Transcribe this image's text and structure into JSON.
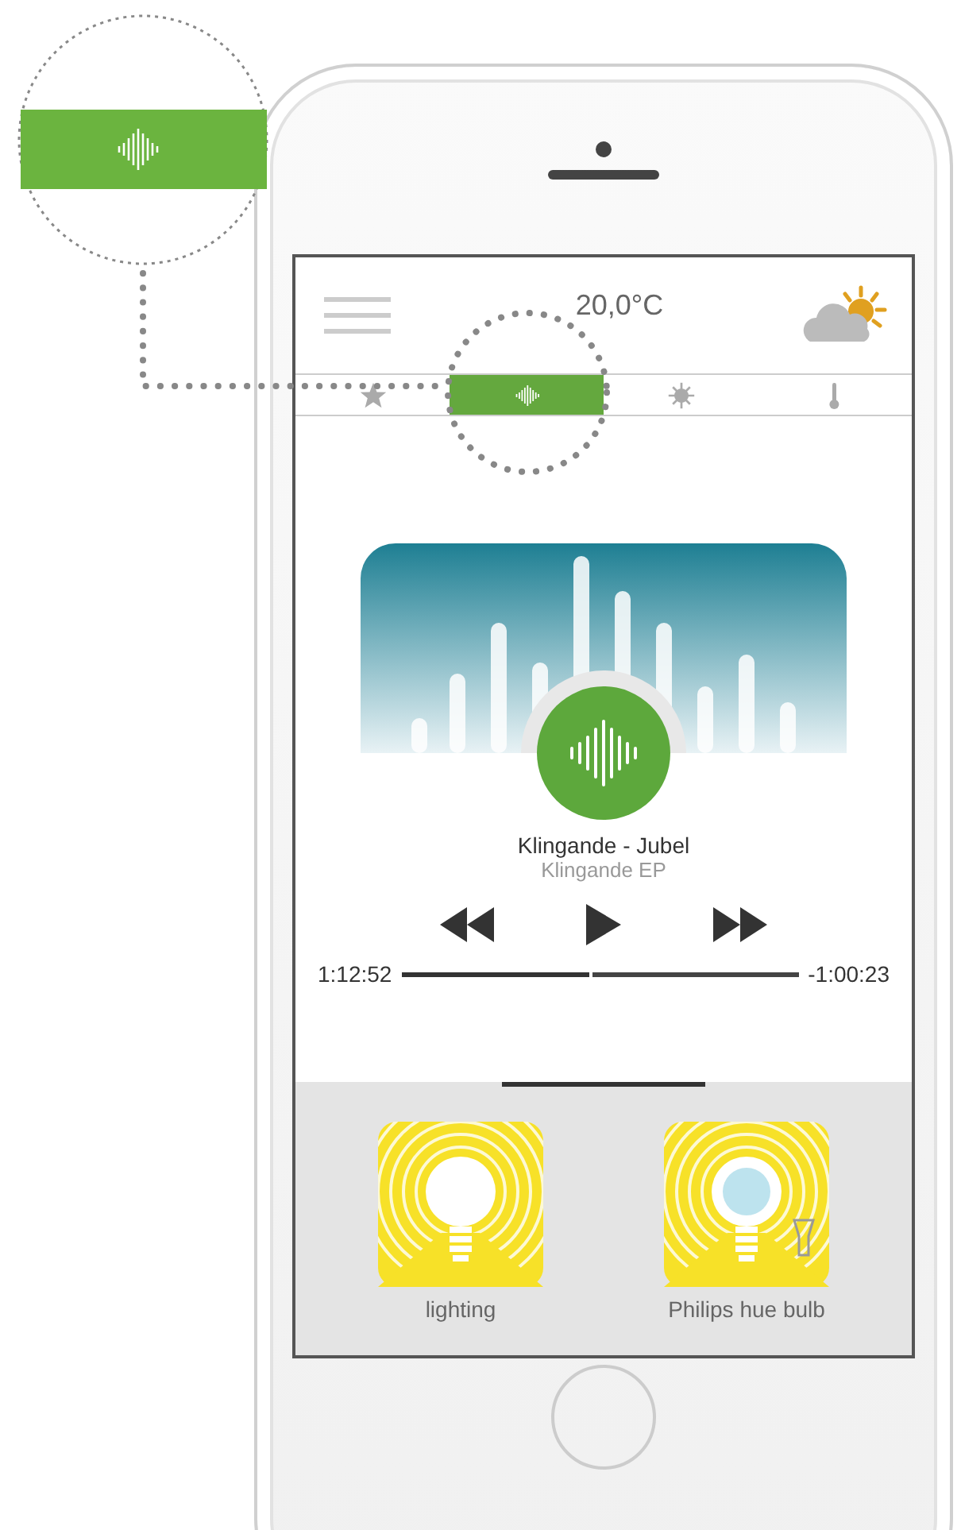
{
  "header": {
    "temperature": "20,0°C"
  },
  "tabs": [
    {
      "kind": "favorites",
      "selected": false
    },
    {
      "kind": "sound",
      "selected": true
    },
    {
      "kind": "light",
      "selected": false
    },
    {
      "kind": "temperature",
      "selected": false
    }
  ],
  "player": {
    "title": "Klingande - Jubel",
    "album": "Klingande EP",
    "elapsed": "1:12:52",
    "remaining": "-1:00:23",
    "level": 0.48
  },
  "devices": [
    {
      "kind": "bulb",
      "label": "lighting"
    },
    {
      "kind": "hue",
      "label": "Philips hue bulb"
    }
  ]
}
